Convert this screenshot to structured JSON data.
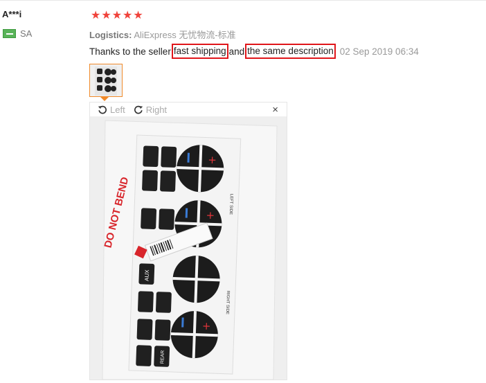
{
  "review": {
    "username": "A***i",
    "country_code": "SA",
    "rating": 5,
    "logistics_label": "Logistics:",
    "logistics_value": "AliExpress 无忧物流-标准",
    "text_prefix": "Thanks to the seller",
    "highlight_1": "fast shipping",
    "text_middle": "and",
    "highlight_2": "the same description",
    "date": "02 Sep 2019 06:34"
  },
  "viewer": {
    "rotate_left_label": "Left",
    "rotate_right_label": "Right",
    "close_label": "×"
  },
  "photo": {
    "sticker_text": "DO NOT BEND",
    "button_labels": [
      "AUX",
      "REAR"
    ],
    "side_labels": [
      "LEFT SIDE",
      "RIGHT SIDE"
    ]
  },
  "colors": {
    "star": "#f0433b",
    "highlight_border": "#e0151a",
    "thumb_border": "#f08a2a"
  }
}
